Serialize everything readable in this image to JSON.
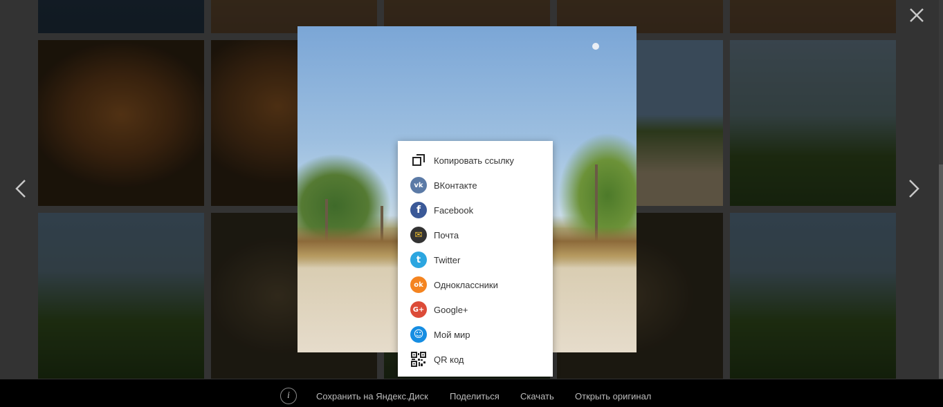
{
  "share_menu": {
    "items": [
      {
        "label": "Копировать ссылку",
        "icon": "copy-link-icon"
      },
      {
        "label": "ВКонтакте",
        "icon": "vk-icon",
        "glyph": "vk",
        "color": "#5b7aa6"
      },
      {
        "label": "Facebook",
        "icon": "facebook-icon",
        "glyph": "f",
        "color": "#3b5998"
      },
      {
        "label": "Почта",
        "icon": "mail-icon",
        "glyph": "✉",
        "color": "#333333"
      },
      {
        "label": "Twitter",
        "icon": "twitter-icon",
        "glyph": "t",
        "color": "#2ca6e0"
      },
      {
        "label": "Одноклассники",
        "icon": "odnoklassniki-icon",
        "glyph": "ok",
        "color": "#f48420"
      },
      {
        "label": "Google+",
        "icon": "google-plus-icon",
        "glyph": "G+",
        "color": "#dc4b38"
      },
      {
        "label": "Мой мир",
        "icon": "moy-mir-icon",
        "glyph": "☺",
        "color": "#168de2"
      },
      {
        "label": "QR код",
        "icon": "qr-code-icon"
      }
    ]
  },
  "bottom_bar": {
    "info_glyph": "i",
    "save_to_disk": "Сохранить на Яндекс.Диск",
    "share": "Поделиться",
    "download": "Скачать",
    "open_original": "Открыть оригинал"
  },
  "colors": {
    "overlay_bg": "#333333",
    "bottom_bar_bg": "#000000",
    "bar_text": "#bdbdbd",
    "menu_bg": "#ffffff"
  }
}
